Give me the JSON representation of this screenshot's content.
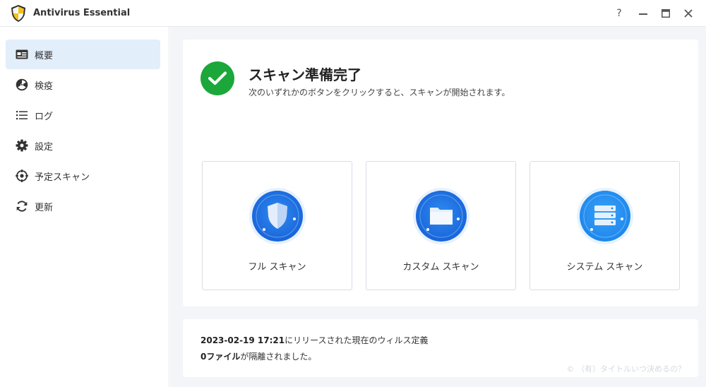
{
  "app": {
    "title": "Antivirus Essential"
  },
  "window_controls": {
    "help": "?",
    "minimize": "—",
    "maximize": "❐",
    "close": "✕"
  },
  "sidebar": {
    "items": [
      {
        "label": "概要",
        "icon": "overview-card-icon",
        "active": true
      },
      {
        "label": "検疫",
        "icon": "quarantine-radiation-icon",
        "active": false
      },
      {
        "label": "ログ",
        "icon": "log-list-icon",
        "active": false
      },
      {
        "label": "設定",
        "icon": "settings-gear-icon",
        "active": false
      },
      {
        "label": "予定スキャン",
        "icon": "scheduled-scan-target-icon",
        "active": false
      },
      {
        "label": "更新",
        "icon": "update-refresh-icon",
        "active": false
      }
    ]
  },
  "status": {
    "title": "スキャン準備完了",
    "subtitle": "次のいずれかのボタンをクリックすると、スキャンが開始されます。",
    "icon": "check-icon",
    "color": "#1ba73a"
  },
  "scan_options": [
    {
      "label": "フル スキャン",
      "icon": "shield-icon"
    },
    {
      "label": "カスタム スキャン",
      "icon": "folder-icon"
    },
    {
      "label": "システム スキャン",
      "icon": "server-icon"
    }
  ],
  "info": {
    "definition_date": "2023-02-19 17:21",
    "definition_text": "にリリースされた現在のウィルス定義",
    "quarantine_count": "0ファイル",
    "quarantine_text": "が隔離されました。"
  },
  "watermark": "© （有）タイトルいつ決めるの？"
}
